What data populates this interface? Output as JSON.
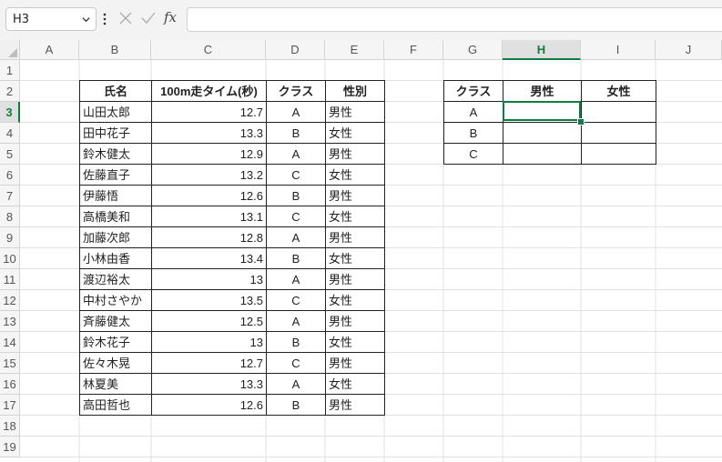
{
  "name_box": "H3",
  "formula": "",
  "icons": {
    "cancel": "close-icon",
    "enter": "check-icon",
    "function": "fx-icon",
    "dropdown": "chevron-down-icon"
  },
  "fx_label": "fx",
  "columns": [
    "A",
    "B",
    "C",
    "D",
    "E",
    "F",
    "G",
    "H",
    "I",
    "J"
  ],
  "rows": [
    "1",
    "2",
    "3",
    "4",
    "5",
    "6",
    "7",
    "8",
    "9",
    "10",
    "11",
    "12",
    "13",
    "14",
    "15",
    "16",
    "17",
    "18",
    "19"
  ],
  "selected_cell": "H3",
  "colors": {
    "accent": "#107c41",
    "header_bg": "#f5f5f5"
  },
  "table1": {
    "headers": [
      "氏名",
      "100m走タイム(秒)",
      "クラス",
      "性別"
    ],
    "rows": [
      [
        "山田太郎",
        "12.7",
        "A",
        "男性"
      ],
      [
        "田中花子",
        "13.3",
        "B",
        "女性"
      ],
      [
        "鈴木健太",
        "12.9",
        "A",
        "男性"
      ],
      [
        "佐藤直子",
        "13.2",
        "C",
        "女性"
      ],
      [
        "伊藤悟",
        "12.6",
        "B",
        "男性"
      ],
      [
        "高橋美和",
        "13.1",
        "C",
        "女性"
      ],
      [
        "加藤次郎",
        "12.8",
        "A",
        "男性"
      ],
      [
        "小林由香",
        "13.4",
        "B",
        "女性"
      ],
      [
        "渡辺裕太",
        "13",
        "A",
        "男性"
      ],
      [
        "中村さやか",
        "13.5",
        "C",
        "女性"
      ],
      [
        "斉藤健太",
        "12.5",
        "A",
        "男性"
      ],
      [
        "鈴木花子",
        "13",
        "B",
        "女性"
      ],
      [
        "佐々木晃",
        "12.7",
        "C",
        "男性"
      ],
      [
        "林夏美",
        "13.3",
        "A",
        "女性"
      ],
      [
        "高田哲也",
        "12.6",
        "B",
        "男性"
      ]
    ]
  },
  "table2": {
    "headers": [
      "クラス",
      "男性",
      "女性"
    ],
    "rows": [
      [
        "A",
        "",
        ""
      ],
      [
        "B",
        "",
        ""
      ],
      [
        "C",
        "",
        ""
      ]
    ]
  }
}
